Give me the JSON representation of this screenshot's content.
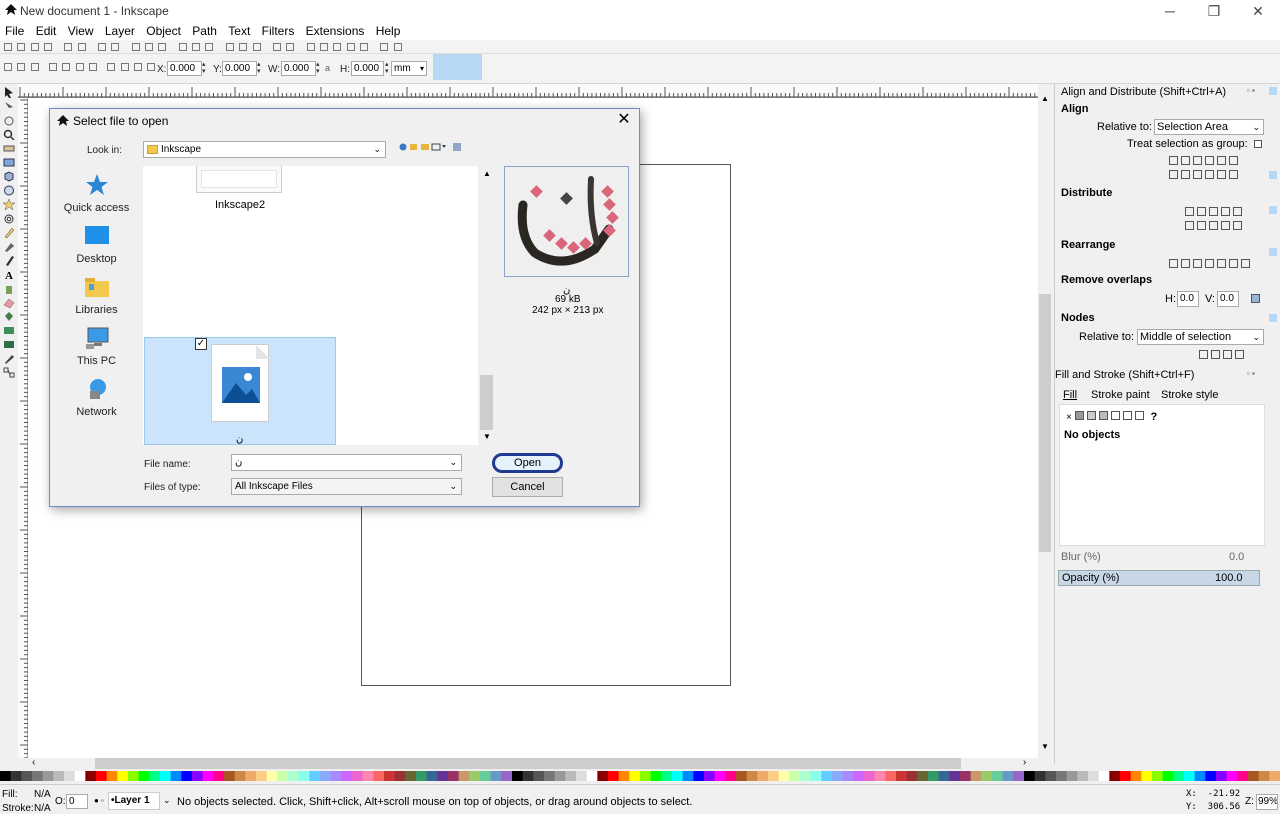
{
  "window": {
    "title": "New document 1 - Inkscape",
    "controls": {
      "minimize": "─",
      "maximize": "❐",
      "close": "✕"
    }
  },
  "menu": [
    "File",
    "Edit",
    "View",
    "Layer",
    "Object",
    "Path",
    "Text",
    "Filters",
    "Extensions",
    "Help"
  ],
  "toolbar": {
    "x_label": "X:",
    "x_value": "0.000",
    "y_label": "Y:",
    "y_value": "0.000",
    "w_label": "W:",
    "w_value": "0.000",
    "h_label": "H:",
    "h_value": "0.000",
    "unit": "mm"
  },
  "dialog": {
    "title": "Select file to open",
    "close": "✕",
    "look_in_label": "Look in:",
    "look_in_value": "Inkscape",
    "places": [
      "Quick access",
      "Desktop",
      "Libraries",
      "This PC",
      "Network"
    ],
    "folder_name": "Inkscape2",
    "selected_item_label": "ن",
    "preview_caption": "ن",
    "preview_size": "69 kB",
    "preview_dims": "242 px × 213 px",
    "file_name_label": "File name:",
    "file_name_value": "ن",
    "files_of_type_label": "Files of type:",
    "files_of_type_value": "All Inkscape Files",
    "open_button": "Open",
    "cancel_button": "Cancel"
  },
  "dock": {
    "align_title": "Align and Distribute (Shift+Ctrl+A)",
    "align_heading": "Align",
    "relative_to_label": "Relative to:",
    "relative_to_value": "Selection Area",
    "treat_group_label": "Treat selection as group:",
    "distribute_heading": "Distribute",
    "rearrange_heading": "Rearrange",
    "remove_overlaps_heading": "Remove overlaps",
    "h_label": "H:",
    "h_value": "0.0",
    "v_label": "V:",
    "v_value": "0.0",
    "nodes_heading": "Nodes",
    "nodes_relative_label": "Relative to:",
    "nodes_relative_value": "Middle of selection",
    "fill_stroke_title": "Fill and Stroke (Shift+Ctrl+F)",
    "tabs": [
      "Fill",
      "Stroke paint",
      "Stroke style"
    ],
    "no_objects": "No objects",
    "blur_label": "Blur (%)",
    "blur_value": "0.0",
    "opacity_label": "Opacity (%)",
    "opacity_value": "100.0"
  },
  "status": {
    "fill_label": "Fill:",
    "fill_value": "N/A",
    "stroke_label": "Stroke:",
    "stroke_value": "N/A",
    "o_label": "O:",
    "o_value": "0",
    "layer": "•Layer 1",
    "message": "No objects selected. Click, Shift+click, Alt+scroll mouse on top of objects, or drag around objects to select.",
    "x_coord": "X:  -21.92",
    "y_coord": "Y:  306.56",
    "zoom_label": "Z:",
    "zoom_value": "99%"
  }
}
